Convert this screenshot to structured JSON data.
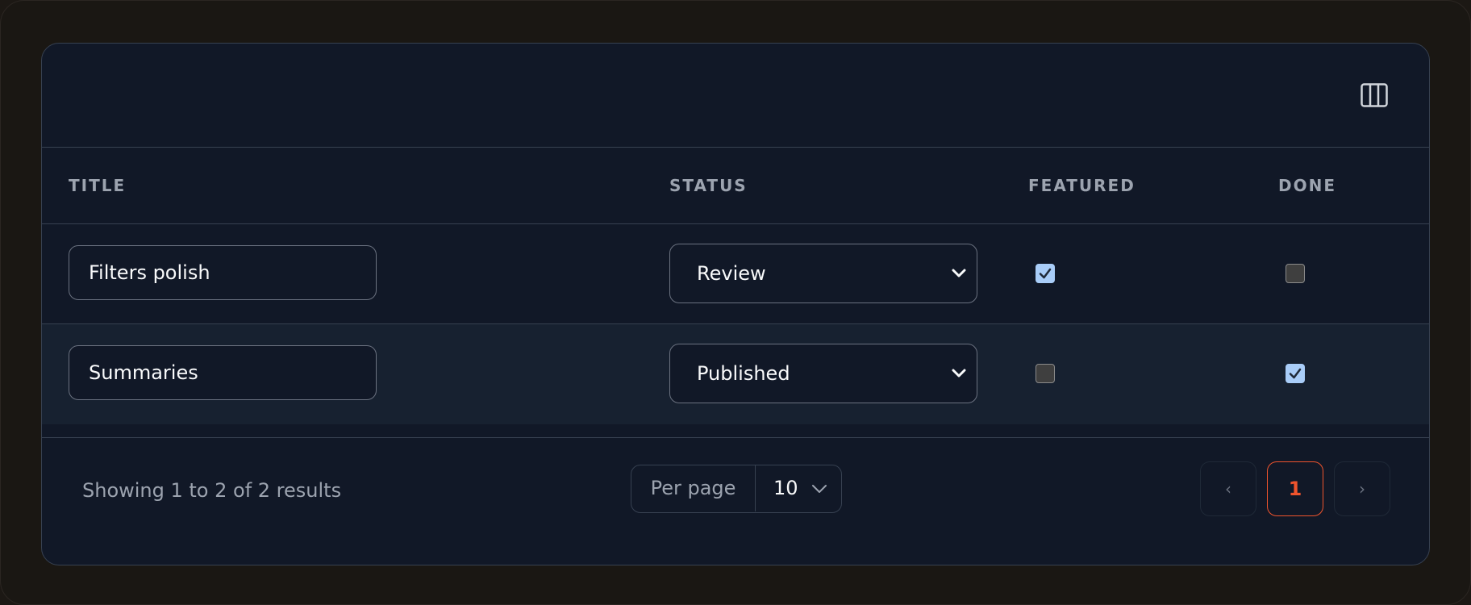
{
  "table": {
    "columns": {
      "title": "TITLE",
      "status": "STATUS",
      "featured": "FEATURED",
      "done": "DONE"
    },
    "rows": [
      {
        "title": "Filters polish",
        "status": "Review",
        "featured": true,
        "done": false
      },
      {
        "title": "Summaries",
        "status": "Published",
        "featured": false,
        "done": true
      }
    ]
  },
  "footer": {
    "results_text": "Showing 1 to 2 of 2 results",
    "per_page_label": "Per page",
    "per_page_value": "10",
    "pagination": {
      "prev": "‹",
      "current_page": "1",
      "next": "›"
    }
  },
  "colors": {
    "accent": "#f0542d",
    "checkbox_checked": "#a9cdf8",
    "card_background": "#111827"
  },
  "icons": {
    "toolbar": "columns-icon",
    "select": "chevron-down-icon",
    "checkbox": "checkmark-icon"
  }
}
